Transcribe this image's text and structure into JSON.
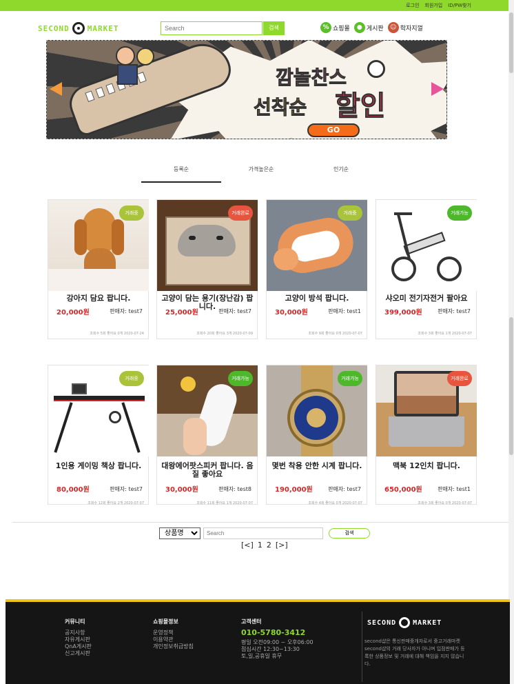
{
  "header": {
    "top_links": [
      "로그인",
      "회원가입",
      "ID/PW찾기"
    ],
    "logo_left": "SECOND",
    "logo_right": "MARKET",
    "search_placeholder": "Search",
    "search_button": "검색",
    "nav": [
      {
        "label": "쇼핑몰",
        "icon": "percent-icon"
      },
      {
        "label": "게시판",
        "icon": "person-icon"
      },
      {
        "label": "학자지껄",
        "icon": "people-icon"
      }
    ]
  },
  "banner": {
    "line1": "깜놀찬스",
    "line2": "선착순",
    "line3": "할인",
    "go_label": "GO"
  },
  "sort_tabs": [
    "등록순",
    "가격높은순",
    "인기순"
  ],
  "products": [
    {
      "title": "강아지 담요 팝니다.",
      "price": "20,000원",
      "seller": "판매자: test7",
      "badge": "거래중",
      "badge_color": "#a9c33a",
      "meta": "조회수 5회 좋아요 0개   2020-07-24"
    },
    {
      "title": "고양이 담는 용기(장난감) 팝니다.",
      "price": "25,000원",
      "seller": "판매자: test7",
      "badge": "거래완료",
      "badge_color": "#e8553e",
      "meta": "조회수 20회 좋아요 3개   2020-07-09"
    },
    {
      "title": "고양이 방석 팝니다.",
      "price": "30,000원",
      "seller": "판매자: test1",
      "badge": "거래중",
      "badge_color": "#a9c33a",
      "meta": "조회수 9회 좋아요 0개   2020-07-07"
    },
    {
      "title": "샤오미 전기자전거 팔아요",
      "price": "399,000원",
      "seller": "판매자: test7",
      "badge": "거래가능",
      "badge_color": "#4cb82a",
      "meta": "조회수 3회 좋아요 1개   2020-07-07"
    },
    {
      "title": "1인용 게이밍 책상 팝니다.",
      "price": "80,000원",
      "seller": "판매자: test7",
      "badge": "거래중",
      "badge_color": "#a9c33a",
      "meta": "조회수 12회 좋아요 2개   2020-07-07"
    },
    {
      "title": "대왕에어팟스피커 팝니다. 음질 좋아요",
      "price": "30,000원",
      "seller": "판매자: test8",
      "badge": "거래가능",
      "badge_color": "#4cb82a",
      "meta": "조회수 11회 좋아요 1개   2020-07-07"
    },
    {
      "title": "몇번 착용 안한 시계 팝니다.",
      "price": "190,000원",
      "seller": "판매자: test7",
      "badge": "거래가능",
      "badge_color": "#4cb82a",
      "meta": "조회수 4회 좋아요 0개   2020-07-07"
    },
    {
      "title": "맥북 12인치 팝니다.",
      "price": "650,000원",
      "seller": "판매자: test1",
      "badge": "거래완료",
      "badge_color": "#e8553e",
      "meta": "조회수 3회 좋아요 0개   2020-07-07"
    }
  ],
  "bottom_search": {
    "select_value": "상품명",
    "placeholder": "Search",
    "button": "검색"
  },
  "pager": {
    "prev": "[<]",
    "pages": [
      "1",
      "2"
    ],
    "next": "[>]"
  },
  "footer": {
    "community_title": "커뮤니티",
    "community_items": [
      "공지사항",
      "자유게시판",
      "QnA게시판",
      "신고게시판"
    ],
    "shop_title": "쇼핑몰정보",
    "shop_items": [
      "운영정책",
      "이용약관",
      "개인정보취급방침"
    ],
    "cs_title": "고객센터",
    "phone": "010-5780-3412",
    "hours": [
      "평일 오전09:00 ~ 오후06:00",
      "점심시간 12:30~13:30",
      "토,일,공휴일 휴무"
    ],
    "logo_left": "SECOND",
    "logo_right": "MARKET",
    "notice": "second샵은 통신판매중개자로서 중고거래마켓 second샵의 거래 당사자가 아니며 입점판매가 등록한 상품정보 및 거래에 대해 책임을 지지 않습니다."
  }
}
